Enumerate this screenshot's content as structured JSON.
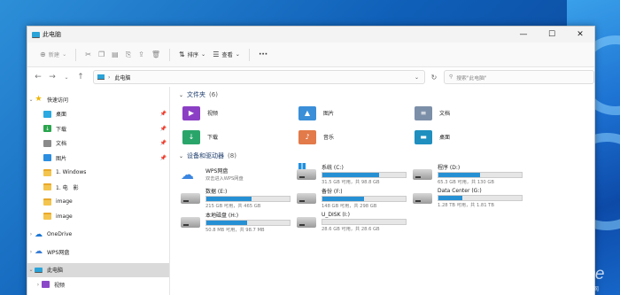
{
  "window": {
    "title": "此电脑",
    "controls": [
      "—",
      "☐",
      "✕"
    ]
  },
  "cmdbar": {
    "new_label": "新建",
    "sort_label": "排序",
    "view_label": "查看",
    "more_label": "···"
  },
  "address": {
    "location": "此电脑",
    "search_placeholder": "搜索\"此电脑\""
  },
  "sidebar": {
    "quick_access": "快速访问",
    "items": [
      {
        "label": "桌面",
        "pinned": true
      },
      {
        "label": "下载",
        "pinned": true
      },
      {
        "label": "文档",
        "pinned": true
      },
      {
        "label": "图片",
        "pinned": true
      },
      {
        "label": "1. Windows",
        "pinned": false
      },
      {
        "label": "1. 电　影",
        "pinned": false
      },
      {
        "label": "image",
        "pinned": false
      },
      {
        "label": "image",
        "pinned": false
      }
    ],
    "onedrive": "OneDrive",
    "wps": "WPS网盘",
    "this_pc": "此电脑",
    "videos": "视频"
  },
  "folders": {
    "header": "文件夹",
    "count": "(6)",
    "items": [
      "视频",
      "图片",
      "文档",
      "下载",
      "音乐",
      "桌面"
    ]
  },
  "drives": {
    "header": "设备和驱动器",
    "count": "(8)",
    "items": [
      {
        "name": "WPS网盘",
        "sub": "双击进入WPS网盘",
        "fill": null
      },
      {
        "name": "系统 (C:)",
        "sub": "31.5 GB 可用，共 98.8 GB",
        "fill": 0.68
      },
      {
        "name": "程序 (D:)",
        "sub": "65.3 GB 可用，共 130 GB",
        "fill": 0.5
      },
      {
        "name": "数据 (E:)",
        "sub": "215 GB 可用，共 465 GB",
        "fill": 0.54
      },
      {
        "name": "备份 (F:)",
        "sub": "148 GB 可用，共 298 GB",
        "fill": 0.5
      },
      {
        "name": "Data Center (G:)",
        "sub": "1.28 TB 可用，共 1.81 TB",
        "fill": 0.29
      },
      {
        "name": "本地磁盘 (H:)",
        "sub": "50.8 MB 可用，共 98.7 MB",
        "fill": 0.49
      },
      {
        "name": "U_DISK (I:)",
        "sub": "28.6 GB 可用，共 28.6 GB",
        "fill": 0.0
      }
    ]
  },
  "watermark": {
    "brand": "PConline",
    "sub": "太平洋电脑网"
  }
}
